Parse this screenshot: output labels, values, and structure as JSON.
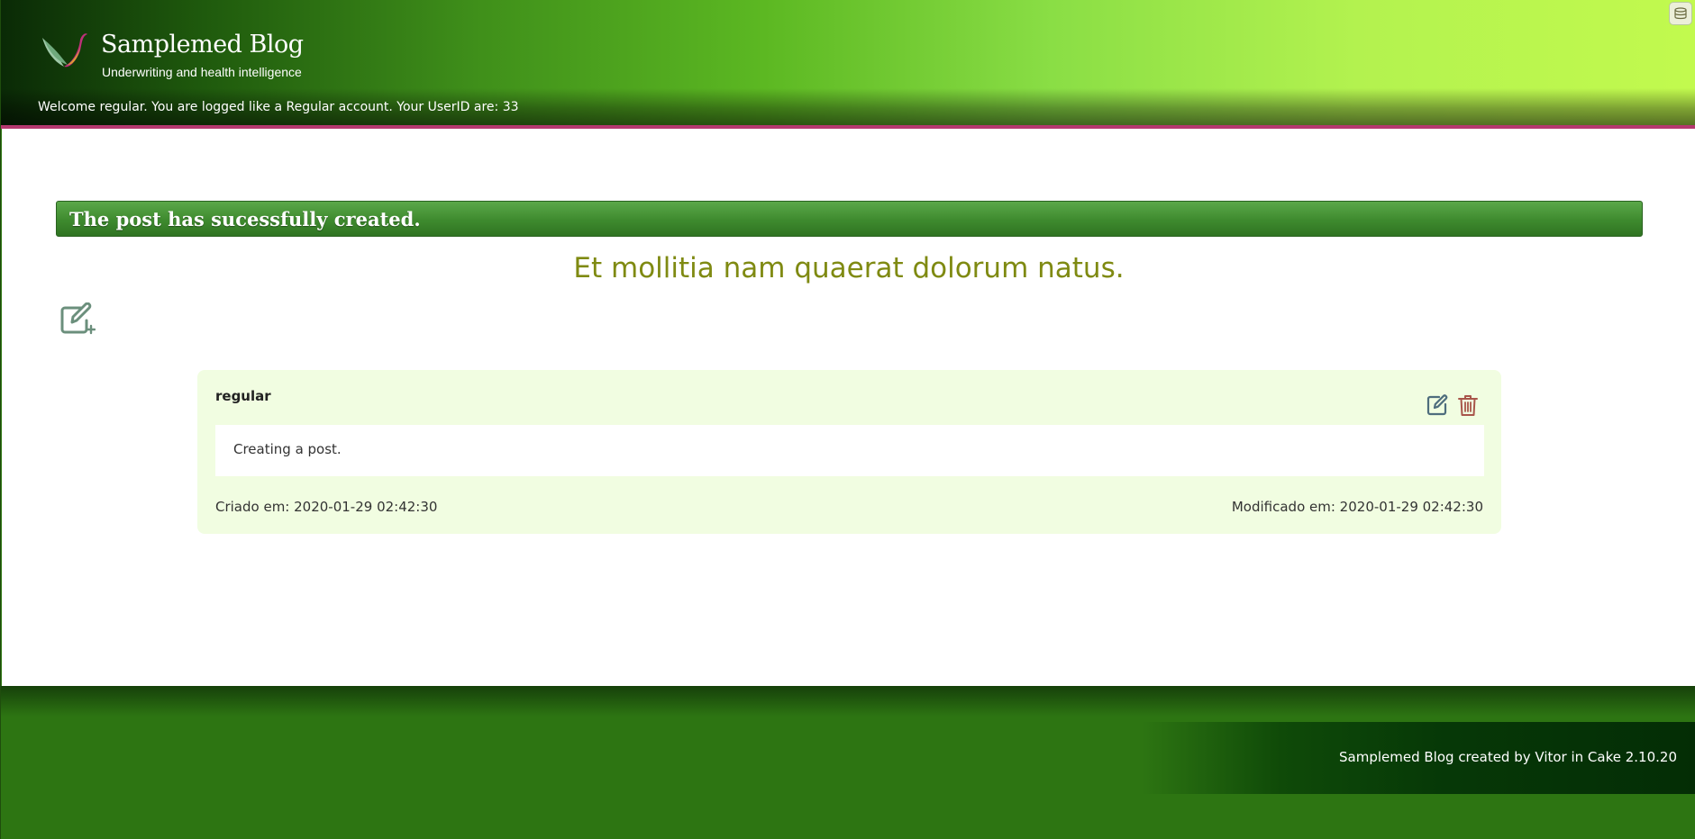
{
  "header": {
    "title": "Samplemed Blog",
    "tagline": "Underwriting and health intelligence",
    "welcome": "Welcome regular. You are logged like a Regular account. Your UserID are: 33"
  },
  "flash": {
    "message": "The post has sucessfully created."
  },
  "post": {
    "title": "Et mollitia nam quaerat dolorum natus."
  },
  "comment": {
    "author": "regular",
    "body": "Creating a post.",
    "created": "Criado em: 2020-01-29 02:42:30",
    "modified": "Modificado em: 2020-01-29 02:42:30"
  },
  "footer": {
    "credit": "Samplemed Blog created by Vitor in Cake 2.10.20"
  },
  "icons": {
    "logo": "bird-logo-icon",
    "new_post": "edit-add-icon",
    "edit": "edit-icon",
    "delete": "trash-icon",
    "corner": "cake-icon"
  },
  "colors": {
    "accent_pink": "#b5386f",
    "post_title": "#7f8a12",
    "comment_bg": "#f1fde1",
    "flash_green": "#3e8a2e",
    "footer_green": "#2d7512"
  }
}
